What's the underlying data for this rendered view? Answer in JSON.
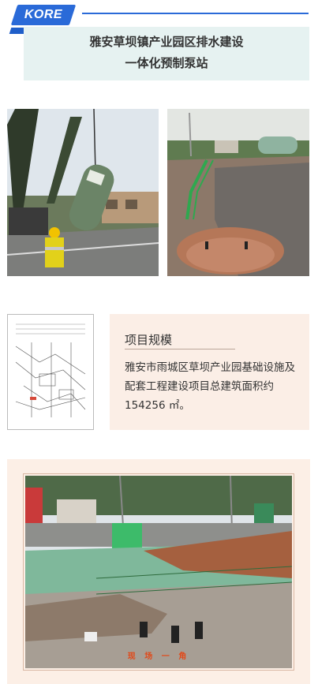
{
  "header": {
    "brand": "KORE",
    "title_line1": "雅安草坝镇产业园区排水建设",
    "title_line2": "一体化预制泵站"
  },
  "project": {
    "heading": "项目规模",
    "description": "雅安市雨城区草坝产业园基础设施及配套工程建设项目总建筑面积约154256 ㎡。"
  },
  "site": {
    "caption": "现 场 一 角"
  },
  "colors": {
    "brand_blue": "#2a6ad8",
    "title_bg": "#e6f2f1",
    "scale_bg": "#fbeee6",
    "site_bg": "#fcefe6",
    "caption_red": "#e04a1b"
  }
}
